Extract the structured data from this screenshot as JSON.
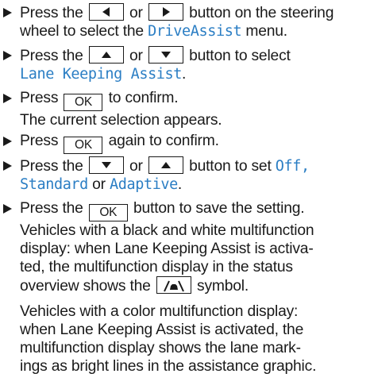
{
  "steps": [
    {
      "lines": [
        {
          "t1": "Press the",
          "t2": "or",
          "t3": "button on the steering"
        },
        {
          "t1": "wheel to select the",
          "disp": "DriveAssist",
          "t2": "menu."
        }
      ],
      "icons": [
        "arrow-left-icon",
        "arrow-right-icon"
      ]
    },
    {
      "lines": [
        {
          "t1": "Press the",
          "t2": "or",
          "t3": "button to select"
        },
        {
          "disp": "Lane Keeping Assist",
          "t2": "."
        }
      ],
      "icons": [
        "arrow-up-icon",
        "arrow-down-icon"
      ]
    },
    {
      "lines": [
        {
          "t1": "Press",
          "key": "OK",
          "t2": "to confirm."
        },
        {
          "t1": "The current selection appears."
        }
      ]
    },
    {
      "lines": [
        {
          "t1": "Press",
          "key": "OK",
          "t2": "again to confirm."
        }
      ]
    },
    {
      "lines": [
        {
          "t1": "Press the",
          "t2": "or",
          "t3": "button to set",
          "disp": "Off,"
        },
        {
          "disp1": "Standard",
          "t1": "or",
          "disp2": "Adaptive",
          "t2": "."
        }
      ],
      "icons": [
        "arrow-down-icon",
        "arrow-up-icon"
      ]
    },
    {
      "lines": [
        {
          "t1": "Press the",
          "key": "OK",
          "t2": "button to save the setting."
        },
        {
          "t1": "Vehicles with a black and white multifunction"
        },
        {
          "t1": "display: when Lane Keeping Assist is activa-"
        },
        {
          "t1": "ted, the multifunction display in the status"
        },
        {
          "t1": "overview shows the",
          "t2": "symbol."
        }
      ],
      "icons": [
        "lane-keeping-symbol-icon"
      ],
      "para": [
        "Vehicles with a color multifunction display:",
        "when Lane Keeping Assist is activated, the",
        "multifunction display shows the lane mark-",
        "ings as bright lines in the assistance graphic."
      ]
    }
  ]
}
